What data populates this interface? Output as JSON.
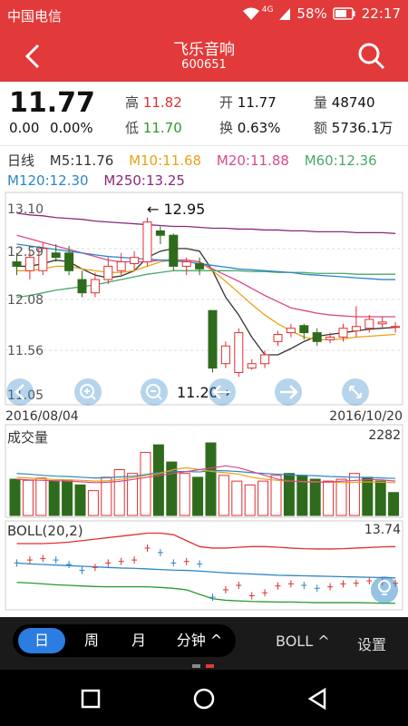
{
  "status_bar": {
    "carrier": "中国电信",
    "network": "4G",
    "battery": "58%",
    "time": "22:17"
  },
  "header": {
    "title": "飞乐音响",
    "code": "600651"
  },
  "quote": {
    "price": "11.77",
    "change": "0.00",
    "change_pct": "0.00%",
    "high_label": "高",
    "high": "11.82",
    "low_label": "低",
    "low": "11.70",
    "open_label": "开",
    "open": "11.77",
    "turnover_label": "换",
    "turnover": "0.63%",
    "volume_label": "量",
    "volume": "48740",
    "amount_label": "额",
    "amount": "5736.1万"
  },
  "ma_legend": {
    "period": "日线",
    "ma5": "M5:11.76",
    "ma10": "M10:11.68",
    "ma20": "M20:11.88",
    "ma60": "M60:12.36",
    "ma120": "M120:12.30",
    "ma250": "M250:13.25"
  },
  "colors": {
    "brand_red": "#e23a3a",
    "up": "#e03030",
    "down": "#2f6b1c",
    "ma5": "#333333",
    "ma10": "#e8a317",
    "ma20": "#d84a8a",
    "ma60": "#4aa86a",
    "ma120": "#2e86c8",
    "ma250": "#8b2a7a",
    "tab_active": "#2b7de1"
  },
  "controls": {
    "left_icon": "chevron-left-icon",
    "zoom_in_icon": "zoom-in-icon",
    "zoom_out_icon": "zoom-out-icon",
    "pan_left_icon": "arrow-left-icon",
    "pan_right_icon": "arrow-right-icon",
    "fullscreen_icon": "expand-icon",
    "bulb_icon": "lightbulb-icon"
  },
  "chart_data": [
    {
      "type": "candlestick",
      "title": "",
      "ylabels": [
        "13.10",
        "12.59",
        "12.08",
        "11.56",
        "11.05"
      ],
      "ylim": [
        11.05,
        13.1
      ],
      "date_start": "2016/08/04",
      "date_end": "2016/10/20",
      "annotations": [
        {
          "label": "← 12.95",
          "price": 12.95
        },
        {
          "label": "11.20→",
          "price": 11.2
        }
      ],
      "candles": [
        {
          "o": 12.5,
          "c": 12.45,
          "h": 12.6,
          "l": 12.35
        },
        {
          "o": 12.4,
          "c": 12.55,
          "h": 12.62,
          "l": 12.3
        },
        {
          "o": 12.4,
          "c": 12.65,
          "h": 12.72,
          "l": 12.35
        },
        {
          "o": 12.6,
          "c": 12.55,
          "h": 12.7,
          "l": 12.5
        },
        {
          "o": 12.6,
          "c": 12.4,
          "h": 12.68,
          "l": 12.35
        },
        {
          "o": 12.3,
          "c": 12.15,
          "h": 12.4,
          "l": 12.1
        },
        {
          "o": 12.15,
          "c": 12.3,
          "h": 12.38,
          "l": 12.1
        },
        {
          "o": 12.3,
          "c": 12.45,
          "h": 12.55,
          "l": 12.25
        },
        {
          "o": 12.4,
          "c": 12.5,
          "h": 12.6,
          "l": 12.35
        },
        {
          "o": 12.48,
          "c": 12.55,
          "h": 12.62,
          "l": 12.4
        },
        {
          "o": 12.5,
          "c": 12.95,
          "h": 13.0,
          "l": 12.45
        },
        {
          "o": 12.85,
          "c": 12.8,
          "h": 12.9,
          "l": 12.7
        },
        {
          "o": 12.8,
          "c": 12.45,
          "h": 12.82,
          "l": 12.4
        },
        {
          "o": 12.45,
          "c": 12.5,
          "h": 12.55,
          "l": 12.35
        },
        {
          "o": 12.48,
          "c": 12.42,
          "h": 12.55,
          "l": 12.35
        },
        {
          "o": 11.95,
          "c": 11.3,
          "h": 11.95,
          "l": 11.25
        },
        {
          "o": 11.35,
          "c": 11.55,
          "h": 11.6,
          "l": 11.3
        },
        {
          "o": 11.25,
          "c": 11.7,
          "h": 11.75,
          "l": 11.2
        },
        {
          "o": 11.3,
          "c": 11.35,
          "h": 11.4,
          "l": 11.28
        },
        {
          "o": 11.35,
          "c": 11.45,
          "h": 11.5,
          "l": 11.3
        },
        {
          "o": 11.6,
          "c": 11.68,
          "h": 11.72,
          "l": 11.55
        },
        {
          "o": 11.7,
          "c": 11.75,
          "h": 11.8,
          "l": 11.65
        },
        {
          "o": 11.78,
          "c": 11.7,
          "h": 11.8,
          "l": 11.62
        },
        {
          "o": 11.7,
          "c": 11.6,
          "h": 11.75,
          "l": 11.55
        },
        {
          "o": 11.62,
          "c": 11.65,
          "h": 11.7,
          "l": 11.58
        },
        {
          "o": 11.65,
          "c": 11.75,
          "h": 11.8,
          "l": 11.6
        },
        {
          "o": 11.72,
          "c": 11.77,
          "h": 12.0,
          "l": 11.65
        },
        {
          "o": 11.75,
          "c": 11.85,
          "h": 11.9,
          "l": 11.7
        },
        {
          "o": 11.8,
          "c": 11.82,
          "h": 11.88,
          "l": 11.75
        },
        {
          "o": 11.77,
          "c": 11.77,
          "h": 11.82,
          "l": 11.7
        }
      ],
      "series": [
        {
          "name": "M5",
          "values": [
            12.45,
            12.45,
            12.48,
            12.52,
            12.5,
            12.42,
            12.35,
            12.32,
            12.34,
            12.4,
            12.55,
            12.62,
            12.65,
            12.65,
            12.62,
            12.4,
            12.1,
            11.9,
            11.65,
            11.45,
            11.45,
            11.52,
            11.6,
            11.66,
            11.68,
            11.7,
            11.72,
            11.74,
            11.75,
            11.76
          ]
        },
        {
          "name": "M10",
          "values": [
            12.4,
            12.4,
            12.42,
            12.45,
            12.45,
            12.42,
            12.4,
            12.38,
            12.38,
            12.4,
            12.45,
            12.5,
            12.52,
            12.52,
            12.5,
            12.4,
            12.28,
            12.15,
            12.02,
            11.9,
            11.8,
            11.72,
            11.65,
            11.62,
            11.62,
            11.63,
            11.65,
            11.66,
            11.67,
            11.68
          ]
        },
        {
          "name": "M20",
          "values": [
            12.8,
            12.76,
            12.72,
            12.68,
            12.64,
            12.6,
            12.56,
            12.52,
            12.5,
            12.5,
            12.5,
            12.52,
            12.52,
            12.52,
            12.5,
            12.42,
            12.35,
            12.28,
            12.2,
            12.12,
            12.05,
            11.98,
            11.95,
            11.92,
            11.9,
            11.89,
            11.88,
            11.88,
            11.88,
            11.88
          ]
        },
        {
          "name": "M60",
          "values": [
            12.1,
            12.12,
            12.15,
            12.18,
            12.2,
            12.22,
            12.24,
            12.27,
            12.3,
            12.33,
            12.36,
            12.38,
            12.4,
            12.4,
            12.4,
            12.4,
            12.4,
            12.4,
            12.39,
            12.39,
            12.38,
            12.38,
            12.38,
            12.37,
            12.37,
            12.37,
            12.36,
            12.36,
            12.36,
            12.36
          ]
        },
        {
          "name": "M120",
          "values": [
            12.7,
            12.68,
            12.66,
            12.64,
            12.62,
            12.6,
            12.58,
            12.56,
            12.55,
            12.54,
            12.53,
            12.52,
            12.51,
            12.5,
            12.48,
            12.46,
            12.44,
            12.42,
            12.41,
            12.4,
            12.39,
            12.38,
            12.36,
            12.35,
            12.34,
            12.33,
            12.32,
            12.31,
            12.3,
            12.3
          ]
        },
        {
          "name": "M250",
          "values": [
            13.05,
            13.03,
            13.02,
            13.0,
            12.99,
            12.98,
            12.96,
            12.95,
            12.94,
            12.93,
            12.92,
            12.91,
            12.9,
            12.9,
            12.89,
            12.88,
            12.88,
            12.87,
            12.87,
            12.86,
            12.86,
            12.85,
            12.85,
            12.84,
            12.84,
            12.84,
            12.83,
            12.83,
            12.83,
            12.82
          ]
        }
      ]
    },
    {
      "type": "bar",
      "title": "成交量",
      "ymax_label": "2282",
      "ylim": [
        0,
        2282
      ],
      "values": [
        950,
        920,
        980,
        900,
        930,
        800,
        650,
        1000,
        1200,
        1100,
        1650,
        1850,
        1400,
        1100,
        1000,
        1900,
        1050,
        900,
        800,
        900,
        1050,
        1100,
        1050,
        950,
        900,
        950,
        1100,
        1000,
        900,
        600
      ],
      "up": [
        false,
        true,
        true,
        false,
        false,
        false,
        true,
        true,
        true,
        true,
        true,
        false,
        false,
        true,
        false,
        false,
        true,
        true,
        true,
        true,
        true,
        false,
        false,
        false,
        true,
        true,
        true,
        false,
        false,
        false
      ],
      "series": [
        {
          "name": "MA1",
          "values": [
            1100,
            1080,
            1050,
            1030,
            1020,
            1000,
            980,
            990,
            1010,
            1030,
            1080,
            1130,
            1150,
            1150,
            1140,
            1180,
            1170,
            1150,
            1120,
            1100,
            1080,
            1060,
            1050,
            1040,
            1020,
            1010,
            1000,
            990,
            980,
            970
          ]
        },
        {
          "name": "MA2",
          "values": [
            1000,
            980,
            960,
            940,
            930,
            920,
            900,
            910,
            950,
            1000,
            1050,
            1100,
            1200,
            1250,
            1200,
            1150,
            1120,
            1080,
            1000,
            950,
            920,
            900,
            890,
            880,
            870,
            860,
            870,
            880,
            870,
            860
          ]
        },
        {
          "name": "MA3",
          "values": [
            950,
            930,
            920,
            910,
            900,
            880,
            860,
            870,
            900,
            950,
            1000,
            1050,
            1100,
            1150,
            1200,
            1250,
            1300,
            1250,
            1150,
            1050,
            950,
            900,
            880,
            870,
            880,
            900,
            920,
            940,
            930,
            900
          ]
        }
      ]
    },
    {
      "type": "line",
      "title": "BOLL(20,2)",
      "ymax_label": "13.74",
      "ylim": [
        11.0,
        13.74
      ],
      "series": [
        {
          "name": "UPPER",
          "values": [
            13.1,
            13.1,
            13.1,
            13.12,
            13.15,
            13.2,
            13.25,
            13.3,
            13.35,
            13.4,
            13.45,
            13.45,
            13.4,
            13.2,
            13.0,
            12.95,
            12.95,
            12.98,
            13.0,
            13.0,
            12.98,
            12.95,
            12.93,
            12.92,
            12.92,
            12.93,
            12.95,
            12.97,
            12.99,
            13.0
          ]
        },
        {
          "name": "MID",
          "values": [
            12.45,
            12.42,
            12.4,
            12.38,
            12.36,
            12.34,
            12.32,
            12.3,
            12.28,
            12.27,
            12.25,
            12.23,
            12.21,
            12.2,
            12.18,
            12.15,
            12.12,
            12.1,
            12.08,
            12.06,
            12.04,
            12.03,
            12.02,
            12.01,
            12.0,
            11.99,
            11.98,
            11.97,
            11.96,
            11.95
          ]
        },
        {
          "name": "LOWER",
          "values": [
            11.8,
            11.78,
            11.75,
            11.72,
            11.7,
            11.68,
            11.66,
            11.65,
            11.65,
            11.65,
            11.65,
            11.63,
            11.6,
            11.55,
            11.4,
            11.25,
            11.2,
            11.18,
            11.16,
            11.15,
            11.14,
            11.14,
            11.13,
            11.12,
            11.12,
            11.12,
            11.12,
            11.11,
            11.1,
            11.1
          ]
        }
      ],
      "marks": [
        12.45,
        12.55,
        12.6,
        12.55,
        12.4,
        12.2,
        12.3,
        12.45,
        12.5,
        12.55,
        12.95,
        12.8,
        12.45,
        12.5,
        12.42,
        11.3,
        11.55,
        11.7,
        11.35,
        11.45,
        11.68,
        11.75,
        11.7,
        11.6,
        11.65,
        11.75,
        11.77,
        11.85,
        11.82,
        11.77
      ]
    }
  ],
  "bottom_bar": {
    "tabs": [
      "日",
      "周",
      "月",
      "分钟 ^"
    ],
    "active_index": 0,
    "indicator_button": "BOLL ^",
    "settings_button": "设置"
  },
  "nav_bar": {
    "back_icon": "triangle-back-icon",
    "home_icon": "circle-home-icon",
    "recents_icon": "square-recents-icon"
  }
}
